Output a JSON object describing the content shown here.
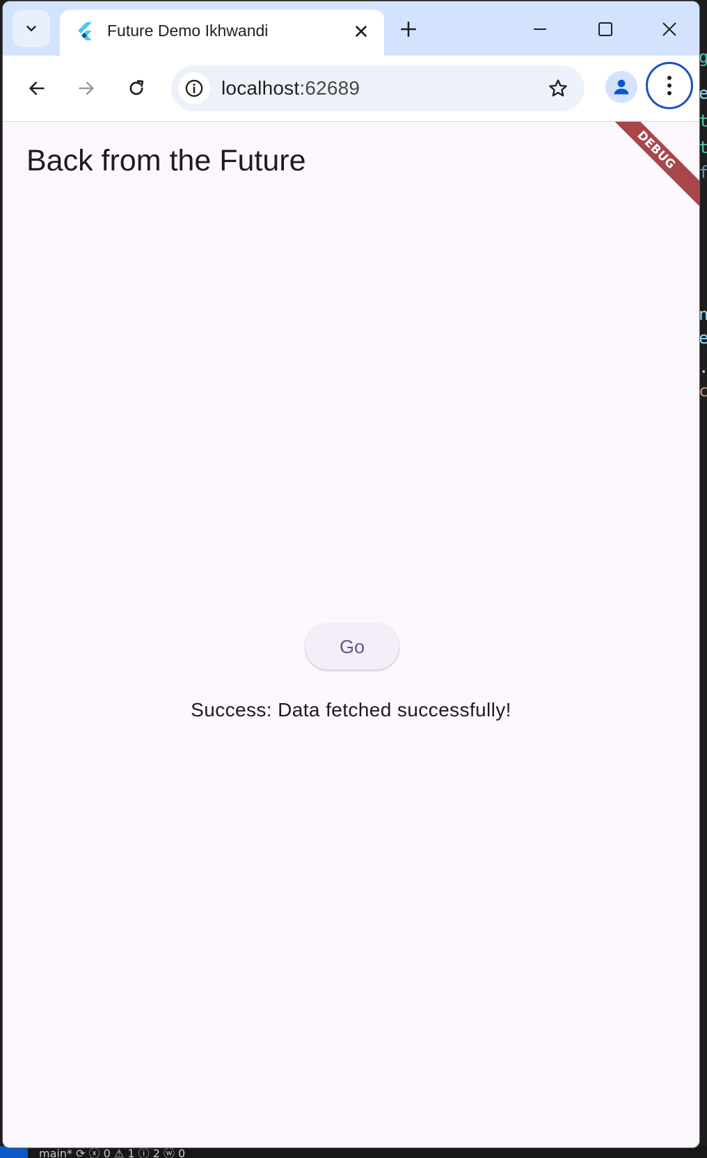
{
  "browser": {
    "tab_title": "Future Demo Ikhwandi",
    "url_host": "localhost",
    "url_port": ":62689",
    "icons": {
      "tab_search": "chevron-down-icon",
      "favicon": "flutter-logo-icon",
      "tab_close": "close-icon",
      "new_tab": "plus-icon",
      "minimize": "minimize-icon",
      "maximize": "maximize-icon",
      "close_window": "close-icon",
      "back": "arrow-left-icon",
      "forward": "arrow-right-icon",
      "reload": "reload-icon",
      "site_info": "info-icon",
      "bookmark": "star-icon",
      "profile": "person-icon",
      "menu": "more-vert-icon"
    }
  },
  "app": {
    "title": "Back from the Future",
    "debug_banner": "DEBUG",
    "go_button_label": "Go",
    "result_text": "Success: Data fetched successfully!"
  },
  "background_editor": {
    "status_text": "main*  ⟳  ⓧ 0 ⚠ 1 ⓘ 2    ⓦ 0"
  },
  "colors": {
    "titlebar": "#d3e3fd",
    "app_background": "#fcf7fc",
    "button_text": "#65558f",
    "debug_banner": "#a8474a",
    "focus_ring": "#1d4fc2"
  }
}
